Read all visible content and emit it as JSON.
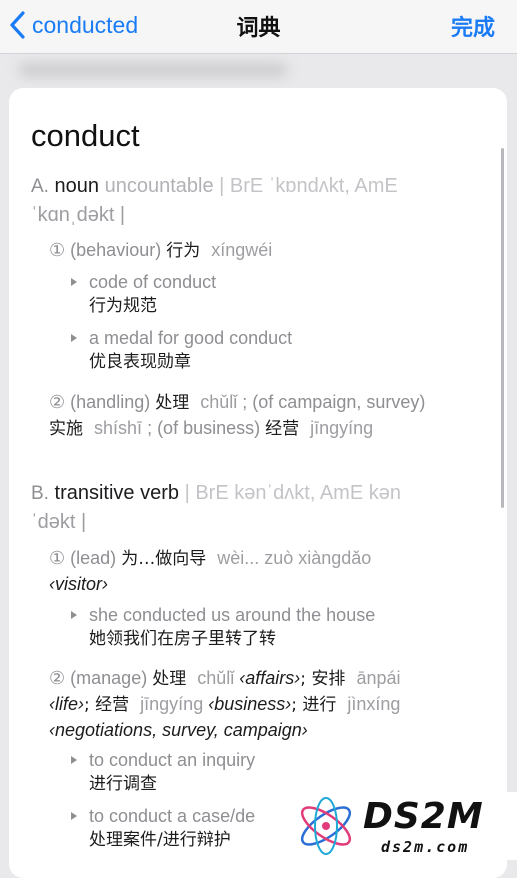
{
  "nav": {
    "back_label": "conducted",
    "title": "词典",
    "done_label": "完成"
  },
  "entry": {
    "headword": "conduct",
    "noun": {
      "letter": "A.",
      "pos": "noun",
      "note": "uncountable",
      "pron_line1": "| BrE ˈkɒndʌkt, AmE",
      "pron_line2": "ˈkɑnˌdəkt |",
      "sense1": {
        "num": "①",
        "label": "(behaviour)",
        "zh": "行为",
        "py": "xíngwéi",
        "examples": [
          {
            "en": "code of conduct",
            "zh": "行为规范"
          },
          {
            "en": "a medal for good conduct",
            "zh": "优良表现勋章"
          }
        ]
      },
      "sense2": {
        "num": "②",
        "label": "(handling)",
        "zh1": "处理",
        "py1": "chǔlǐ",
        "mid": "; (of campaign, survey)",
        "zh2": "实施",
        "py2": "shíshī",
        "mid2": "; (of business)",
        "zh3": "经营",
        "py3": "jīngyíng"
      }
    },
    "verb": {
      "letter": "B.",
      "pos": "transitive verb",
      "pron_line1": "| BrE kənˈdʌkt, AmE kən",
      "pron_line2": "ˈdəkt |",
      "sense1": {
        "num": "①",
        "label": "(lead)",
        "zh": "为…做向导",
        "py": "wèi... zuò xiàngdǎo",
        "obj": "‹visitor›",
        "examples": [
          {
            "en": "she conducted us around the house",
            "zh": "她领我们在房子里转了转"
          }
        ]
      },
      "sense2": {
        "num": "②",
        "label": "(manage)",
        "zh1": "处理",
        "py1": "chǔlǐ",
        "obj1": "‹affairs›",
        "zh2": "安排",
        "py2": "ānpái",
        "obj2": "‹life›",
        "zh3": "经营",
        "py3": "jīngyíng",
        "obj3": "‹business›",
        "zh4": "进行",
        "py4": "jìnxíng",
        "obj4": "‹negotiations, survey, campaign›",
        "examples": [
          {
            "en": "to conduct an inquiry",
            "zh": "进行调查"
          },
          {
            "en": "to conduct a case/de",
            "zh": "处理案件/进行辩护"
          }
        ]
      }
    }
  },
  "watermark": {
    "brand": "DS2M",
    "site": "ds2m.com"
  },
  "colors": {
    "accent": "#1a7cf5",
    "card": "#ffffff",
    "background": "#e9e9eb"
  }
}
